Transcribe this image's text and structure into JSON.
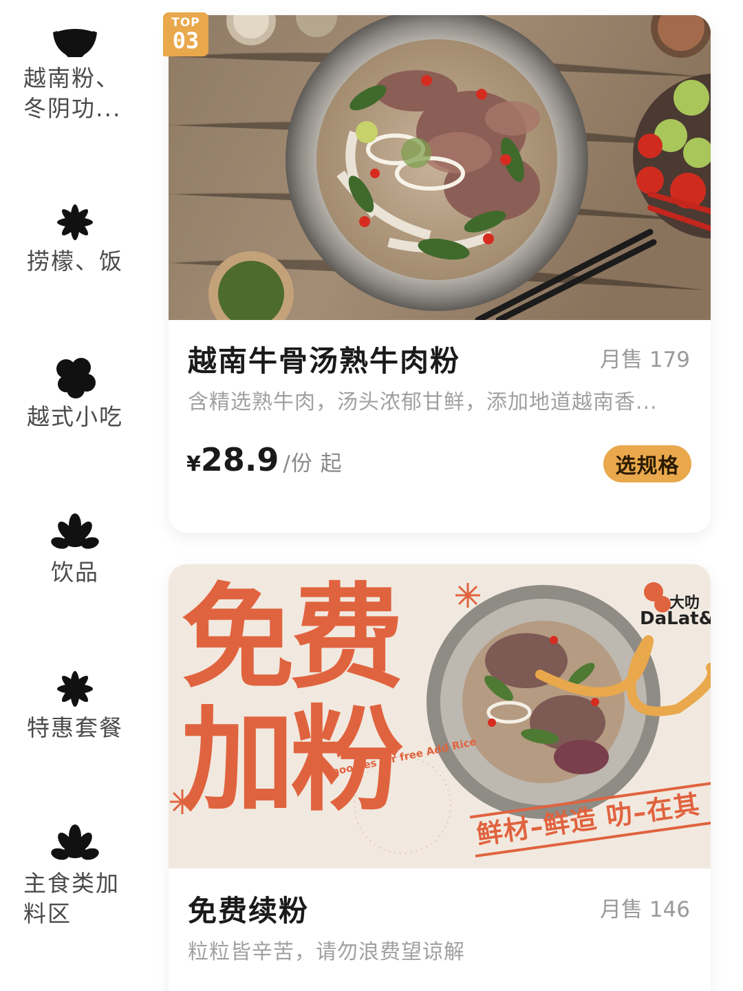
{
  "sidebar": {
    "items": [
      {
        "label": "越南粉、冬阴功...",
        "line1": "越南粉、",
        "line2": "冬阴功...",
        "icon": "bowl-icon"
      },
      {
        "label": "捞檬、饭",
        "icon": "asterisk-flower-icon"
      },
      {
        "label": "越式小吃",
        "icon": "blob-flower-icon"
      },
      {
        "label": "饮品",
        "icon": "lotus-icon"
      },
      {
        "label": "特惠套餐",
        "icon": "asterisk-flower-icon"
      },
      {
        "label": "主食类加料区",
        "line1": "主食类加",
        "line2": "料区",
        "icon": "lotus-icon"
      }
    ]
  },
  "products": [
    {
      "badge_top": "TOP",
      "badge_rank": "03",
      "name": "越南牛骨汤熟牛肉粉",
      "sold": "月售 179",
      "desc": "含精选熟牛肉，汤头浓郁甘鲜，添加地道越南香...",
      "price_symbol": "¥",
      "price": "28.9",
      "unit": "/份 起",
      "button": "选规格"
    },
    {
      "name": "免费续粉",
      "sold": "月售 146",
      "desc": "粒粒皆辛苦，请勿浪费望谅解",
      "banner": {
        "big_line1": "免费",
        "big_line2": "加粉",
        "circle_text": "noodles for free  Add Rice noodles for free  Add Rice",
        "slogan": "鲜材–鲜造 叻–在其",
        "brand_cn": "大叻",
        "brand_en": "DaLat&"
      }
    }
  ],
  "colors": {
    "accent": "#e9a84c",
    "banner_red": "#e0633f",
    "banner_bg": "#f1e9df"
  }
}
